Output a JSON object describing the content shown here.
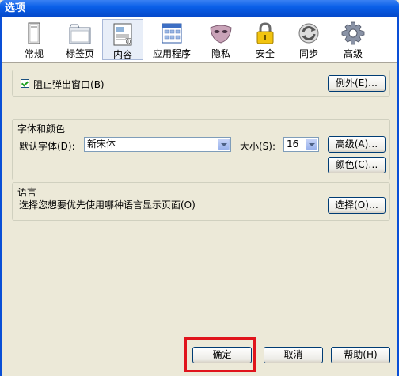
{
  "window": {
    "title": "选项"
  },
  "tabs": [
    {
      "label": "常规",
      "icon": "general-icon"
    },
    {
      "label": "标签页",
      "icon": "tabs-icon"
    },
    {
      "label": "内容",
      "icon": "content-icon"
    },
    {
      "label": "应用程序",
      "icon": "applications-icon"
    },
    {
      "label": "隐私",
      "icon": "privacy-mask-icon"
    },
    {
      "label": "安全",
      "icon": "security-lock-icon"
    },
    {
      "label": "同步",
      "icon": "sync-icon"
    },
    {
      "label": "高级",
      "icon": "advanced-gear-icon"
    }
  ],
  "popup": {
    "checkbox_label": "阻止弹出窗口",
    "checkbox_key": "(B)",
    "checked": true,
    "exceptions_button": "例外(E)…"
  },
  "fonts": {
    "group_title": "字体和颜色",
    "default_font_label": "默认字体(D):",
    "default_font_value": "新宋体",
    "size_label": "大小(S):",
    "size_value": "16",
    "advanced_button": "高级(A)…",
    "colors_button": "颜色(C)…"
  },
  "language": {
    "group_title": "语言",
    "description": "选择您想要优先使用哪种语言显示页面(O)",
    "choose_button": "选择(O)…"
  },
  "footer": {
    "ok_button": "确定",
    "cancel_button": "取消",
    "help_button": "帮助(H)"
  }
}
